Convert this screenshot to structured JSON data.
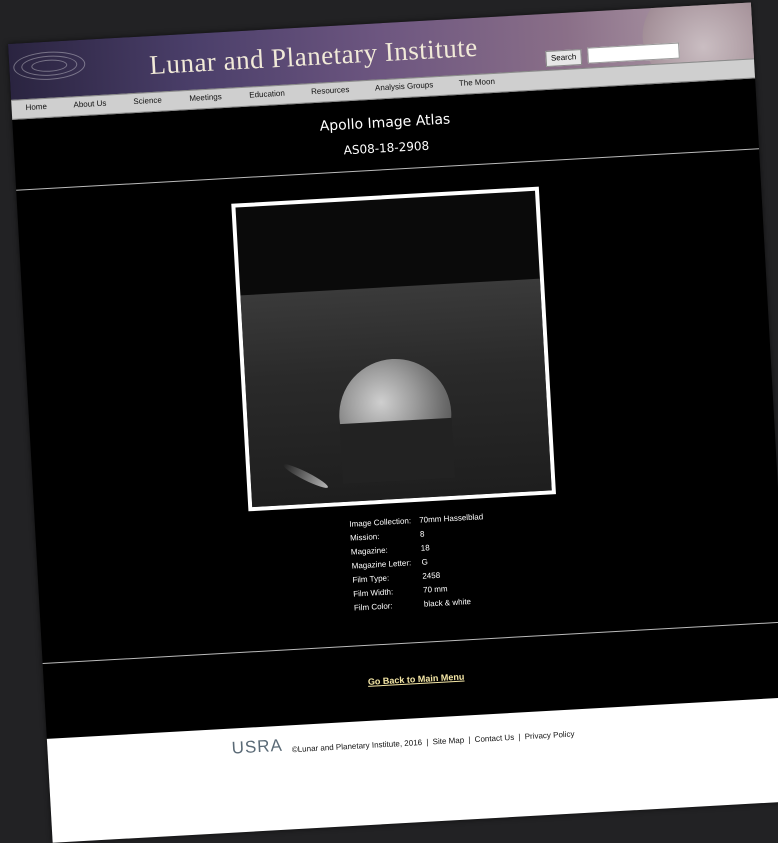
{
  "header": {
    "site_title": "Lunar and Planetary Institute",
    "search_button_label": "Search",
    "search_input_value": ""
  },
  "nav": {
    "items": [
      {
        "label": "Home"
      },
      {
        "label": "About Us"
      },
      {
        "label": "Science"
      },
      {
        "label": "Meetings"
      },
      {
        "label": "Education"
      },
      {
        "label": "Resources"
      },
      {
        "label": "Analysis Groups"
      },
      {
        "label": "The Moon"
      }
    ]
  },
  "main": {
    "title": "Apollo Image Atlas",
    "image_id": "AS08-18-2908",
    "details": [
      {
        "label": "Image Collection:",
        "value": "70mm Hasselblad"
      },
      {
        "label": "Mission:",
        "value": "8"
      },
      {
        "label": "Magazine:",
        "value": "18"
      },
      {
        "label": "Magazine Letter:",
        "value": "G"
      },
      {
        "label": "Film Type:",
        "value": "2458"
      },
      {
        "label": "Film Width:",
        "value": "70 mm"
      },
      {
        "label": "Film Color:",
        "value": "black & white"
      }
    ],
    "back_link": "Go Back to Main Menu"
  },
  "footer": {
    "logo_text": "USRA",
    "copyright": "©Lunar and Planetary Institute, 2016",
    "links": [
      {
        "label": "Site Map"
      },
      {
        "label": "Contact Us"
      },
      {
        "label": "Privacy Policy"
      }
    ]
  },
  "colors": {
    "background": "#000000",
    "link": "#f5e7a6",
    "nav_bar": "#cfcfcf"
  }
}
